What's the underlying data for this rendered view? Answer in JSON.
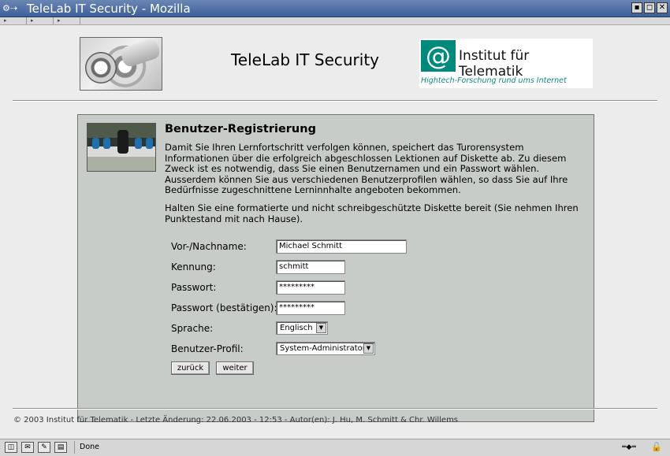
{
  "window": {
    "title": "TeleLab IT Security - Mozilla",
    "controls": [
      "▪",
      "◻",
      "✕"
    ]
  },
  "header": {
    "site_title": "TeleLab IT Security",
    "institute_at": "@",
    "institute_name": "Institut für Telematik",
    "institute_tagline": "Hightech-Forschung rund ums Internet"
  },
  "panel": {
    "heading": "Benutzer-Registrierung",
    "paragraph_1": "Damit Sie Ihren Lernfortschritt verfolgen können, speichert das Turorensystem Informationen über die erfolgreich abgeschlossen Lektionen auf Diskette ab. Zu diesem Zweck ist es notwendig, dass Sie einen Benutzernamen und ein Passwort wählen. Ausserdem können Sie aus verschiedenen Benutzerprofilen wählen, so dass Sie auf Ihre Bedürfnisse zugeschnittene Lerninnhalte angeboten bekommen.",
    "paragraph_2": "Halten Sie eine formatierte und nicht schreibgeschützte Diskette bereit (Sie nehmen Ihren Punktestand mit nach Hause)."
  },
  "form": {
    "name_label": "Vor-/Nachname:",
    "name_value": "Michael Schmitt",
    "login_label": "Kennung:",
    "login_value": "schmitt",
    "password_label": "Passwort:",
    "password_value": "*********",
    "password_confirm_label": "Passwort (bestätigen):",
    "password_confirm_value": "*********",
    "language_label": "Sprache:",
    "language_value": "Englisch",
    "profile_label": "Benutzer-Profil:",
    "profile_value": "System-Administrator",
    "back_button": "zurück",
    "next_button": "weiter"
  },
  "footer": {
    "text": "© 2003 Institut für Telematik - Letzte Änderung: 22.06.2003 - 12:53 - Autor(en): J. Hu, M. Schmitt & Chr. Willems"
  },
  "statusbar": {
    "status_text": "Done"
  }
}
